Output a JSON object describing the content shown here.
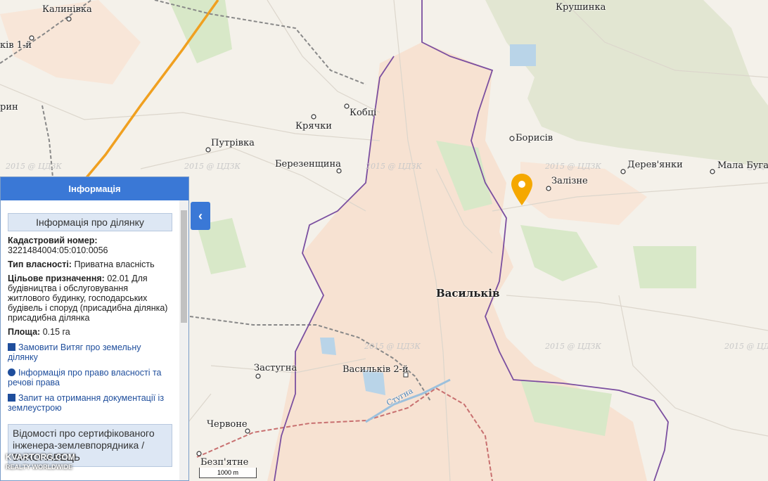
{
  "places": [
    {
      "id": "kalynivka",
      "text": "Калинівка"
    },
    {
      "id": "kalynivka1",
      "text": "ків 1-й"
    },
    {
      "id": "kryshynka",
      "text": "Крушинка"
    },
    {
      "id": "ryn",
      "text": "рин"
    },
    {
      "id": "kobtsi",
      "text": "Кобці"
    },
    {
      "id": "kriachky",
      "text": "Крячки"
    },
    {
      "id": "putrivka",
      "text": "Путрівка"
    },
    {
      "id": "boryshiv",
      "text": "Борисів"
    },
    {
      "id": "berezenshchyna",
      "text": "Березенщина"
    },
    {
      "id": "derevianky",
      "text": "Дерев'янки"
    },
    {
      "id": "mala-buhaivka",
      "text": "Мала Буга"
    },
    {
      "id": "zalizne",
      "text": "Залізне"
    },
    {
      "id": "vasylkiv",
      "text": "Васильків"
    },
    {
      "id": "zastuhna",
      "text": "Застугна"
    },
    {
      "id": "vasylkiv2",
      "text": "Васильків 2-й"
    },
    {
      "id": "chervone",
      "text": "Червоне"
    },
    {
      "id": "bezpiatne",
      "text": "Безп'ятне"
    },
    {
      "id": "stuhna",
      "text": "Стугна"
    }
  ],
  "watermark": "2015 @ ЦДЗК",
  "panel": {
    "header": "Інформація",
    "section_title": "Інформація про ділянку",
    "cadastre_label": "Кадастровий номер:",
    "cadastre_value": "3221484004:05:010:0056",
    "ownership_label": "Тип власності:",
    "ownership_value": "Приватна власність",
    "purpose_label": "Цільове призначення:",
    "purpose_value": "02.01 Для будівництва і обслуговування житлового будинку, господарських будівель і споруд (присадибна ділянка) присадибна ділянка",
    "area_label": "Площа:",
    "area_value": "0.15 га",
    "link1": "Замовити Витяг про земельну ділянку",
    "link2": "Інформація про право власності та речові права",
    "link3": "Запит на отримання документації із землеустрою",
    "section2": "Відомості про сертифікованого інженера-землевпорядника / ВИКОНАВЕЦЬ"
  },
  "scale": "1000 m",
  "logo": {
    "line1": "KVARTORG.COM",
    "line2": "REALTY WORLDWIDE"
  },
  "colors": {
    "header": "#3a78d6",
    "boundary": "#7b4fa0",
    "rail": "#c87070",
    "road_major": "#f0a020"
  }
}
